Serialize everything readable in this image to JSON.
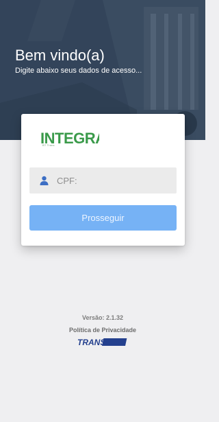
{
  "hero": {
    "title": "Bem vindo(a)",
    "subtitle": "Digite abaixo seus dados de acesso..."
  },
  "logo": {
    "text": "INTEGRA",
    "subtitle": "BT Trans"
  },
  "login": {
    "cpf_placeholder": "CPF:",
    "cpf_value": "",
    "submit_label": "Prosseguir"
  },
  "footer": {
    "version": "Versão: 2.1.32",
    "privacy_label": "Política de Privacidade",
    "brand": "TRANSOFT"
  },
  "icons": {
    "user": "user-icon"
  },
  "colors": {
    "accent_button": "#76b2f5",
    "logo_green": "#3a9a4a",
    "brand_blue": "#24408e"
  }
}
